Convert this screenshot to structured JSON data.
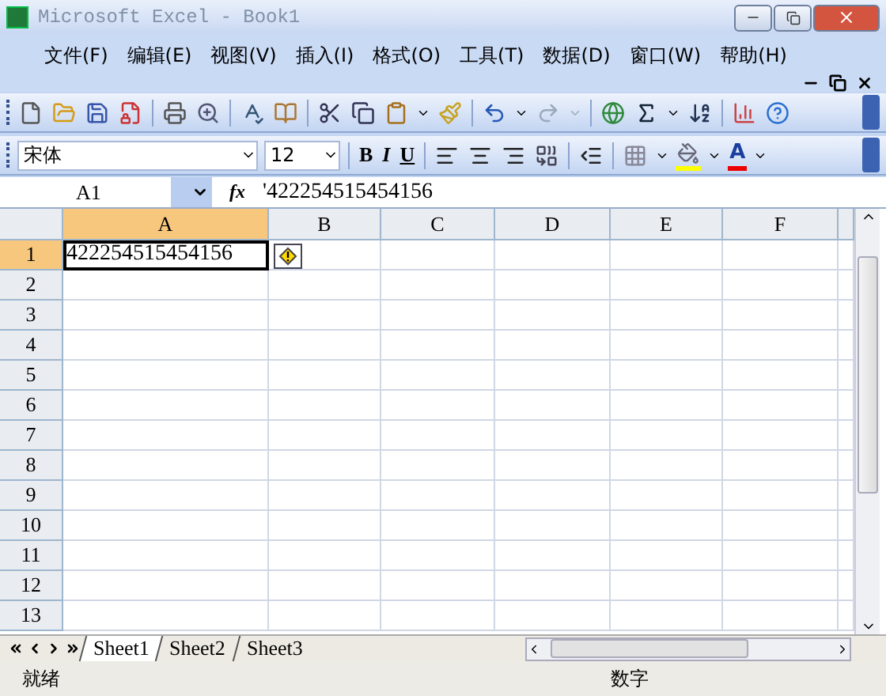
{
  "window": {
    "title": "Microsoft Excel - Book1"
  },
  "menu": [
    {
      "label": "文件(F)"
    },
    {
      "label": "编辑(E)"
    },
    {
      "label": "视图(V)"
    },
    {
      "label": "插入(I)"
    },
    {
      "label": "格式(O)"
    },
    {
      "label": "工具(T)"
    },
    {
      "label": "数据(D)"
    },
    {
      "label": "窗口(W)"
    },
    {
      "label": "帮助(H)"
    }
  ],
  "format_toolbar": {
    "font": "宋体",
    "size": "12",
    "styles": [
      "B",
      "I",
      "U"
    ],
    "font_color_label": "A"
  },
  "formula_bar": {
    "name_box": "A1",
    "fx_label": "fx",
    "formula": "'422254515454156"
  },
  "columns": [
    {
      "label": "A",
      "selected": true
    },
    {
      "label": "B",
      "selected": false
    },
    {
      "label": "C",
      "selected": false
    },
    {
      "label": "D",
      "selected": false
    },
    {
      "label": "E",
      "selected": false
    },
    {
      "label": "F",
      "selected": false
    }
  ],
  "rows": [
    {
      "label": "1",
      "selected": true,
      "cells": [
        "422254515454156"
      ]
    },
    {
      "label": "2",
      "selected": false,
      "cells": []
    },
    {
      "label": "3",
      "selected": false,
      "cells": []
    },
    {
      "label": "4",
      "selected": false,
      "cells": []
    },
    {
      "label": "5",
      "selected": false,
      "cells": []
    },
    {
      "label": "6",
      "selected": false,
      "cells": []
    },
    {
      "label": "7",
      "selected": false,
      "cells": []
    },
    {
      "label": "8",
      "selected": false,
      "cells": []
    },
    {
      "label": "9",
      "selected": false,
      "cells": []
    },
    {
      "label": "10",
      "selected": false,
      "cells": []
    },
    {
      "label": "11",
      "selected": false,
      "cells": []
    },
    {
      "label": "12",
      "selected": false,
      "cells": []
    },
    {
      "label": "13",
      "selected": false,
      "cells": []
    }
  ],
  "sheet_tabs": [
    {
      "label": "Sheet1",
      "selected": true
    },
    {
      "label": "Sheet2",
      "selected": false
    },
    {
      "label": "Sheet3",
      "selected": false
    }
  ],
  "status_bar": {
    "left": "就绪",
    "right": "数字"
  }
}
